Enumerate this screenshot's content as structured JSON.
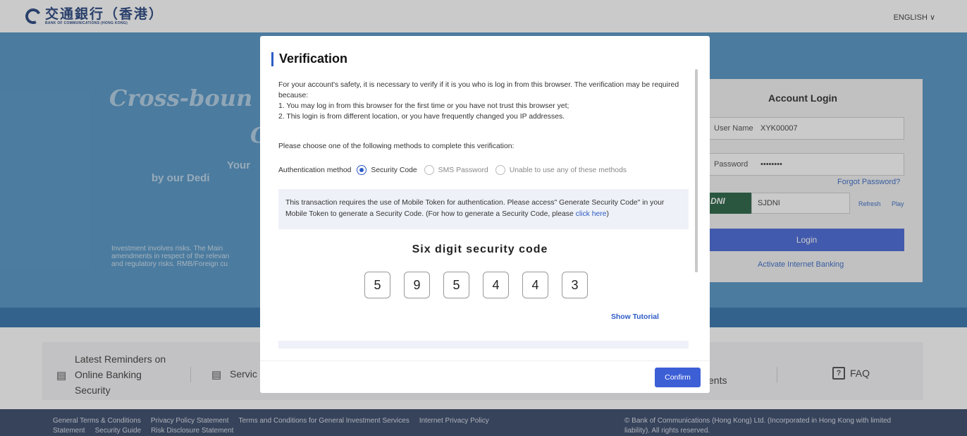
{
  "header": {
    "logo_cn": "交通銀行（香港）",
    "logo_en": "BANK OF COMMUNICATIONS (HONG KONG)",
    "language": "ENGLISH ∨"
  },
  "banner": {
    "title_line1": "Cross-boun",
    "title_line2": "C",
    "sub_line1": "Your",
    "sub_line2": "by our Dedi",
    "disclaimer_line1": "Investment involves risks. The Main",
    "disclaimer_line2": "amendments in respect of the relevan",
    "disclaimer_line3": "and regulatory risks. RMB/Foreign cu"
  },
  "login": {
    "title": "Account Login",
    "username_label": "User Name",
    "username_value": "XYK00007",
    "password_label": "Password",
    "password_value": "••••••••",
    "forgot": "Forgot Password?",
    "captcha_image_text": "DNI",
    "captcha_value": "SJDNI",
    "refresh": "Refresh",
    "play": "Play",
    "login_button": "Login",
    "activate": "Activate Internet Banking"
  },
  "strip": {
    "reminders_line1": "Latest Reminders on",
    "reminders_line2": "Online Banking",
    "reminders_line3": "Security",
    "services": "Servic",
    "ents": "ents",
    "faq_icon": "?",
    "faq": "FAQ"
  },
  "footer": {
    "links": [
      "General Terms & Conditions",
      "Privacy Policy Statement",
      "Terms and Conditions for General Investment Services",
      "Internet Privacy Policy",
      "Statement",
      "Security Guide",
      "Risk Disclosure Statement"
    ],
    "copyright": "© Bank of Communications (Hong Kong) Ltd. (Incorporated in Hong Kong with limited liability). All rights reserved."
  },
  "modal": {
    "title": "Verification",
    "intro_line1": "For your account's safety, it is necessary to verify if it is you who is log in from this browser. The verification may be required because:",
    "intro_line2": "1. You may log in from this browser for the first time or you have not trust this browser yet;",
    "intro_line3": "2. This login is from different location, or you have frequently changed you IP addresses.",
    "choose": "Please choose one of the following methods to complete this verification:",
    "auth_label": "Authentication method",
    "options": [
      "Security Code",
      "SMS Password",
      "Unable to use any of these methods"
    ],
    "selected_option": "Security Code",
    "info_text": "This transaction requires the use of Mobile Token for authentication. Please access\" Generate Security Code\" in your Mobile Token to generate a Security Code. (For how to generate a Security Code, please ",
    "info_link": "click here",
    "info_end": ")",
    "code_label": "Six digit security code",
    "code_digits": [
      "5",
      "9",
      "5",
      "4",
      "4",
      "3"
    ],
    "show_tutorial": "Show Tutorial",
    "confirm": "Confirm"
  },
  "colors": {
    "brand_blue": "#1a3a78",
    "accent": "#2d5bc6",
    "banner": "#4a8fc2",
    "footer": "#2c3e60"
  }
}
